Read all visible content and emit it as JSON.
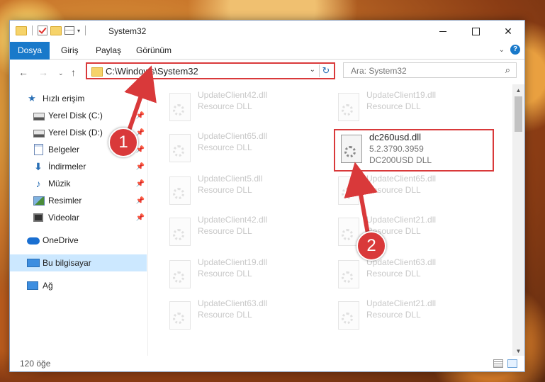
{
  "window": {
    "title": "System32",
    "controls": {
      "minimize": "minimize-icon",
      "maximize": "maximize-icon",
      "close": "close-icon"
    }
  },
  "ribbon": {
    "tabs": [
      "Dosya",
      "Giriş",
      "Paylaş",
      "Görünüm"
    ],
    "help_glyph": "?"
  },
  "address": {
    "path": "C:\\Windows\\System32"
  },
  "search": {
    "placeholder": "Ara: System32"
  },
  "sidebar": {
    "quick_access": "Hızlı erişim",
    "items": [
      {
        "label": "Yerel Disk (C:)",
        "icon": "drive-icon",
        "pinned": true
      },
      {
        "label": "Yerel Disk (D:)",
        "icon": "drive-icon",
        "pinned": true
      },
      {
        "label": "Belgeler",
        "icon": "documents-icon",
        "pinned": true
      },
      {
        "label": "İndirmeler",
        "icon": "downloads-icon",
        "pinned": true
      },
      {
        "label": "Müzik",
        "icon": "music-icon",
        "pinned": true
      },
      {
        "label": "Resimler",
        "icon": "pictures-icon",
        "pinned": true
      },
      {
        "label": "Videolar",
        "icon": "videos-icon",
        "pinned": true
      }
    ],
    "onedrive": "OneDrive",
    "this_pc": "Bu bilgisayar",
    "network": "Ağ"
  },
  "files": {
    "left": [
      {
        "name": "UpdateClient42.dll",
        "desc": "Resource DLL"
      },
      {
        "name": "UpdateClient65.dll",
        "desc": "Resource DLL"
      },
      {
        "name": "UpdateClient5.dll",
        "desc": "Resource DLL"
      },
      {
        "name": "UpdateClient42.dll",
        "desc": "Resource DLL"
      },
      {
        "name": "UpdateClient19.dll",
        "desc": "Resource DLL"
      },
      {
        "name": "UpdateClient63.dll",
        "desc": "Resource DLL"
      }
    ],
    "right": [
      {
        "name": "UpdateClient19.dll",
        "desc": "Resource DLL"
      },
      {
        "name": "UpdateClient65.dll",
        "desc": "Resource DLL"
      },
      {
        "name": "UpdateClient21.dll",
        "desc": "Resource DLL"
      },
      {
        "name": "UpdateClient63.dll",
        "desc": "Resource DLL"
      },
      {
        "name": "UpdateClient21.dll",
        "desc": "Resource DLL"
      }
    ],
    "highlighted": {
      "name": "dc260usd.dll",
      "version": "5.2.3790.3959",
      "desc": "DC200USD DLL"
    }
  },
  "status": {
    "count": "120 öğe"
  },
  "annotations": {
    "step1": "1",
    "step2": "2",
    "color": "#d9393a"
  }
}
